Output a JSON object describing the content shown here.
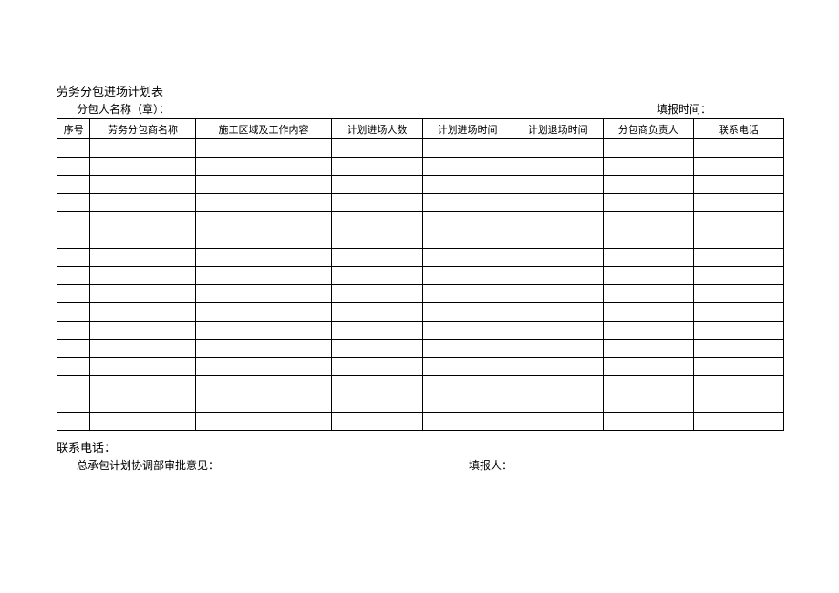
{
  "title": "劳务分包进场计划表",
  "header": {
    "left": "分包人名称（章）：",
    "right": "填报时间："
  },
  "columns": [
    "序号",
    "劳务分包商名称",
    "施工区域及工作内容",
    "计划进场人数",
    "计划进场时间",
    "计划退场时间",
    "分包商负责人",
    "联系电话"
  ],
  "rows": [
    [
      "",
      "",
      "",
      "",
      "",
      "",
      "",
      ""
    ],
    [
      "",
      "",
      "",
      "",
      "",
      "",
      "",
      ""
    ],
    [
      "",
      "",
      "",
      "",
      "",
      "",
      "",
      ""
    ],
    [
      "",
      "",
      "",
      "",
      "",
      "",
      "",
      ""
    ],
    [
      "",
      "",
      "",
      "",
      "",
      "",
      "",
      ""
    ],
    [
      "",
      "",
      "",
      "",
      "",
      "",
      "",
      ""
    ],
    [
      "",
      "",
      "",
      "",
      "",
      "",
      "",
      ""
    ],
    [
      "",
      "",
      "",
      "",
      "",
      "",
      "",
      ""
    ],
    [
      "",
      "",
      "",
      "",
      "",
      "",
      "",
      ""
    ],
    [
      "",
      "",
      "",
      "",
      "",
      "",
      "",
      ""
    ],
    [
      "",
      "",
      "",
      "",
      "",
      "",
      "",
      ""
    ],
    [
      "",
      "",
      "",
      "",
      "",
      "",
      "",
      ""
    ],
    [
      "",
      "",
      "",
      "",
      "",
      "",
      "",
      ""
    ],
    [
      "",
      "",
      "",
      "",
      "",
      "",
      "",
      ""
    ],
    [
      "",
      "",
      "",
      "",
      "",
      "",
      "",
      ""
    ],
    [
      "",
      "",
      "",
      "",
      "",
      "",
      "",
      ""
    ]
  ],
  "footer": {
    "contact": "联系电话：",
    "approval": "总承包计划协调部审批意见：",
    "reporter": "填报人："
  }
}
